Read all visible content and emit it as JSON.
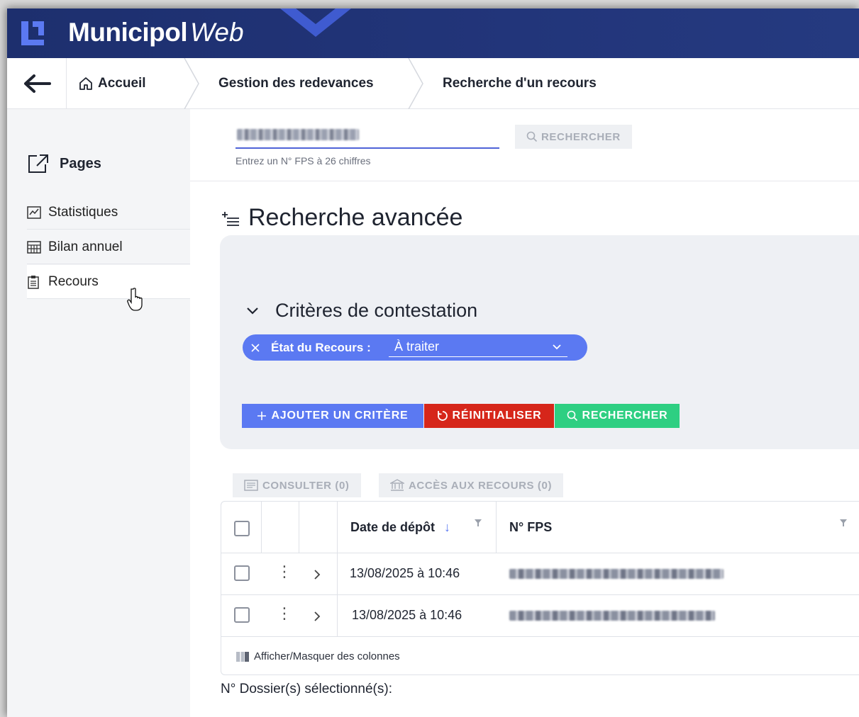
{
  "header": {
    "app_name_bold": "Municipol",
    "app_name_italic": "Web"
  },
  "breadcrumb": {
    "items": [
      "Accueil",
      "Gestion des redevances",
      "Recherche d'un recours"
    ]
  },
  "sidebar": {
    "heading": "Pages",
    "items": [
      {
        "label": "Statistiques",
        "icon": "chart-icon"
      },
      {
        "label": "Bilan annuel",
        "icon": "calendar-grid-icon"
      },
      {
        "label": "Recours",
        "icon": "clipboard-icon",
        "active": true
      }
    ]
  },
  "quick_search": {
    "hint": "Entrez un N° FPS à 26 chiffres",
    "button_label": "RECHERCHER"
  },
  "advanced": {
    "title": "Recherche avancée",
    "section_title": "Critères de contestation",
    "chip_label": "État du Recours :",
    "chip_value": "À traiter",
    "buttons": {
      "add": "AJOUTER UN CRITÈRE",
      "reset": "RÉINITIALISER",
      "search": "RECHERCHER"
    }
  },
  "table": {
    "tools": {
      "consult": "CONSULTER (0)",
      "access": "ACCÈS AUX RECOURS (0)"
    },
    "columns": [
      "Date de dépôt",
      "N° FPS"
    ],
    "rows": [
      {
        "date": "13/08/2025 à 10:46"
      },
      {
        "date": "13/08/2025 à 10:46"
      }
    ],
    "footer": "Afficher/Masquer des colonnes"
  },
  "selection_label": "N° Dossier(s) sélectionné(s):",
  "colors": {
    "header_bg": "#1d2f6e",
    "accent_blue": "#5b79f2",
    "danger_red": "#d93025",
    "success_green": "#2fcf82"
  }
}
